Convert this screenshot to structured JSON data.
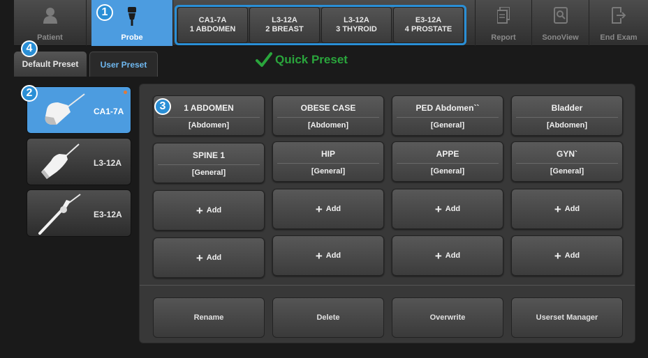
{
  "toolbar": {
    "patient_label": "Patient",
    "probe_label": "Probe",
    "report_label": "Report",
    "sonoview_label": "SonoView",
    "end_exam_label": "End Exam",
    "quick_presets": [
      {
        "probe": "CA1-7A",
        "preset": "1 ABDOMEN"
      },
      {
        "probe": "L3-12A",
        "preset": "2 BREAST"
      },
      {
        "probe": "L3-12A",
        "preset": "3 THYROID"
      },
      {
        "probe": "E3-12A",
        "preset": "4 PROSTATE"
      }
    ]
  },
  "tabs": {
    "default_preset": "Default Preset",
    "user_preset": "User Preset"
  },
  "annotations": {
    "quick_preset_label": "Quick Preset",
    "badge_1": "1",
    "badge_2": "2",
    "badge_3": "3",
    "badge_4": "4"
  },
  "probes": [
    {
      "name": "CA1-7A",
      "selected": true
    },
    {
      "name": "L3-12A",
      "selected": false
    },
    {
      "name": "E3-12A",
      "selected": false
    }
  ],
  "presets": [
    {
      "name": "1 ABDOMEN",
      "category": "[Abdomen]"
    },
    {
      "name": "OBESE CASE",
      "category": "[Abdomen]"
    },
    {
      "name": "PED Abdomen``",
      "category": "[General]"
    },
    {
      "name": "Bladder",
      "category": "[Abdomen]"
    },
    {
      "name": "SPINE 1",
      "category": "[General]"
    },
    {
      "name": "HIP",
      "category": "[General]"
    },
    {
      "name": "APPE",
      "category": "[General]"
    },
    {
      "name": "GYN`",
      "category": "[General]"
    }
  ],
  "add_label": "Add",
  "actions": {
    "rename": "Rename",
    "delete": "Delete",
    "overwrite": "Overwrite",
    "userset_manager": "Userset Manager"
  },
  "colors": {
    "accent_blue": "#4c9ce0",
    "badge_blue": "#2a8fd6",
    "quick_preset_green": "#2aa53c"
  },
  "icons": {
    "patient": "person-icon",
    "probe": "probe-icon",
    "report": "report-icon",
    "sonoview": "sonoview-icon",
    "end_exam": "end-exam-icon",
    "check": "checkmark-icon"
  }
}
